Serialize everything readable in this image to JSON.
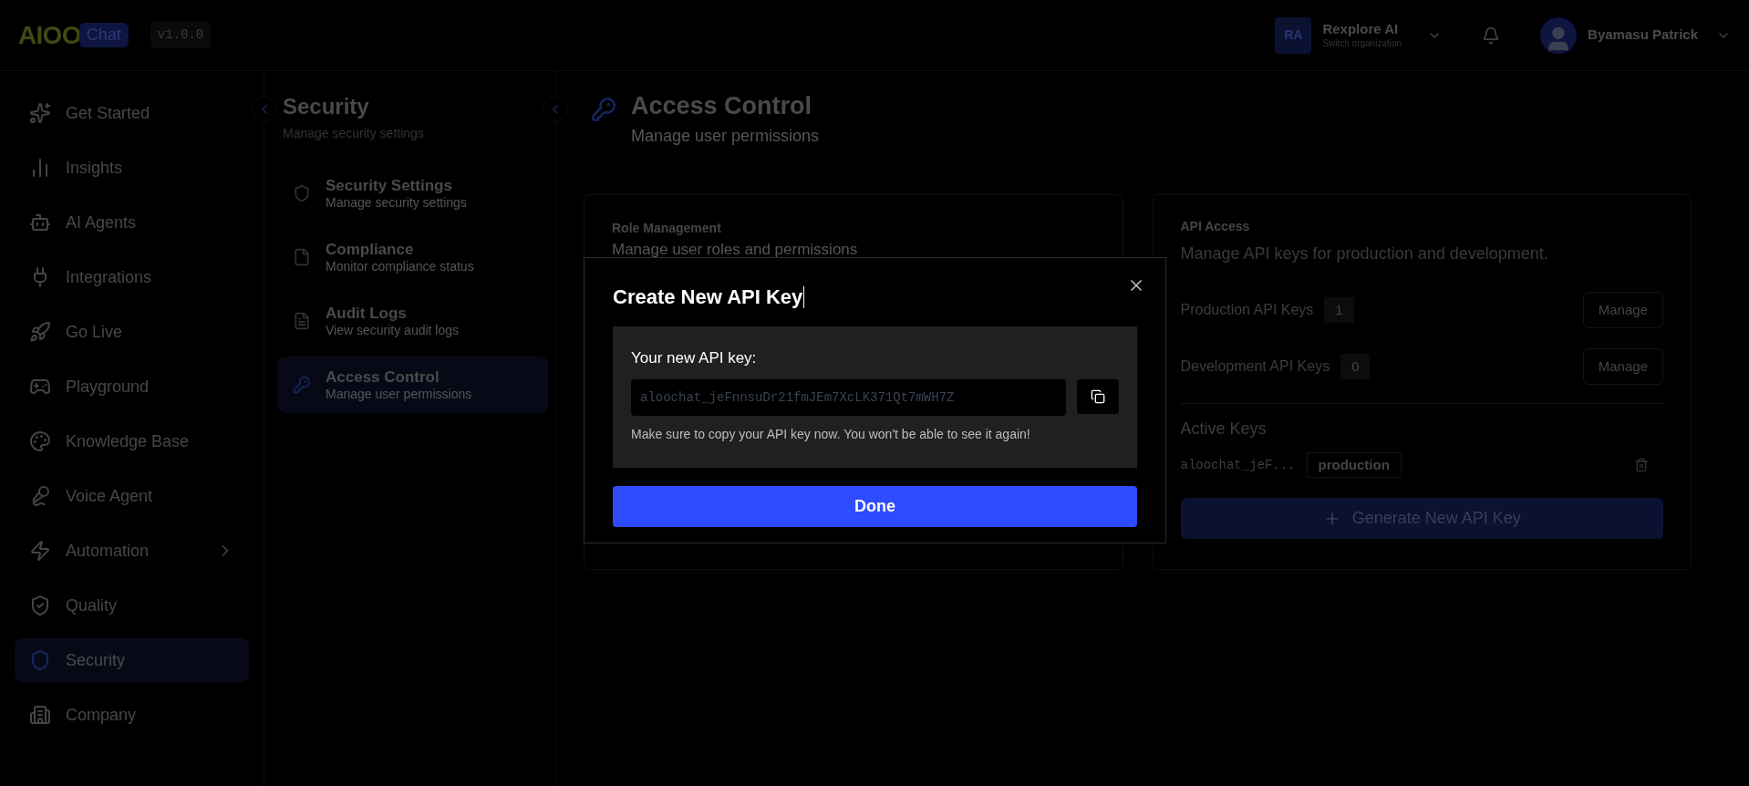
{
  "header": {
    "logo": {
      "mark": "AIOO",
      "badge": "Chat"
    },
    "version": "v1.0.0",
    "organization": {
      "initials": "RA",
      "name": "Rexplore AI",
      "hint": "Switch organization"
    },
    "user": {
      "name": "Byamasu Patrick"
    }
  },
  "sidebar": {
    "items": [
      {
        "label": "Get Started",
        "selected": false,
        "expandable": false
      },
      {
        "label": "Insights",
        "selected": false,
        "expandable": false
      },
      {
        "label": "AI Agents",
        "selected": false,
        "expandable": false
      },
      {
        "label": "Integrations",
        "selected": false,
        "expandable": false
      },
      {
        "label": "Go Live",
        "selected": false,
        "expandable": false
      },
      {
        "label": "Playground",
        "selected": false,
        "expandable": false
      },
      {
        "label": "Knowledge Base",
        "selected": false,
        "expandable": false
      },
      {
        "label": "Voice Agent",
        "selected": false,
        "expandable": false
      },
      {
        "label": "Automation",
        "selected": false,
        "expandable": true
      },
      {
        "label": "Quality",
        "selected": false,
        "expandable": false
      },
      {
        "label": "Security",
        "selected": true,
        "expandable": false
      },
      {
        "label": "Company",
        "selected": false,
        "expandable": false
      }
    ]
  },
  "section_nav": {
    "title": "Security",
    "subtitle": "Manage security settings",
    "items": [
      {
        "title": "Security Settings",
        "description": "Manage security settings",
        "selected": false
      },
      {
        "title": "Compliance",
        "description": "Monitor compliance status",
        "selected": false
      },
      {
        "title": "Audit Logs",
        "description": "View security audit logs",
        "selected": false
      },
      {
        "title": "Access Control",
        "description": "Manage user permissions",
        "selected": true
      }
    ]
  },
  "page": {
    "title": "Access Control",
    "subtitle": "Manage user permissions"
  },
  "role_card": {
    "title": "Role Management",
    "description": "Manage user roles and permissions"
  },
  "api_card": {
    "title": "API Access",
    "description": "Manage API keys for production and development.",
    "key_groups": [
      {
        "label": "Production API Keys",
        "count": "1",
        "action": "Manage"
      },
      {
        "label": "Development API Keys",
        "count": "0",
        "action": "Manage"
      }
    ],
    "active_keys_title": "Active Keys",
    "active_keys": [
      {
        "key": "aloochat_jeF...",
        "environment": "production"
      }
    ],
    "generate_button": "Generate New API Key"
  },
  "dialog": {
    "title": "Create New API Key",
    "key_label": "Your new API key:",
    "key_value": "aloochat_jeFnnsuDr21fmJEm7XcLK371Qt7mWH7Z",
    "warning": "Make sure to copy your API key now. You won't be able to see it again!",
    "done_button": "Done"
  }
}
